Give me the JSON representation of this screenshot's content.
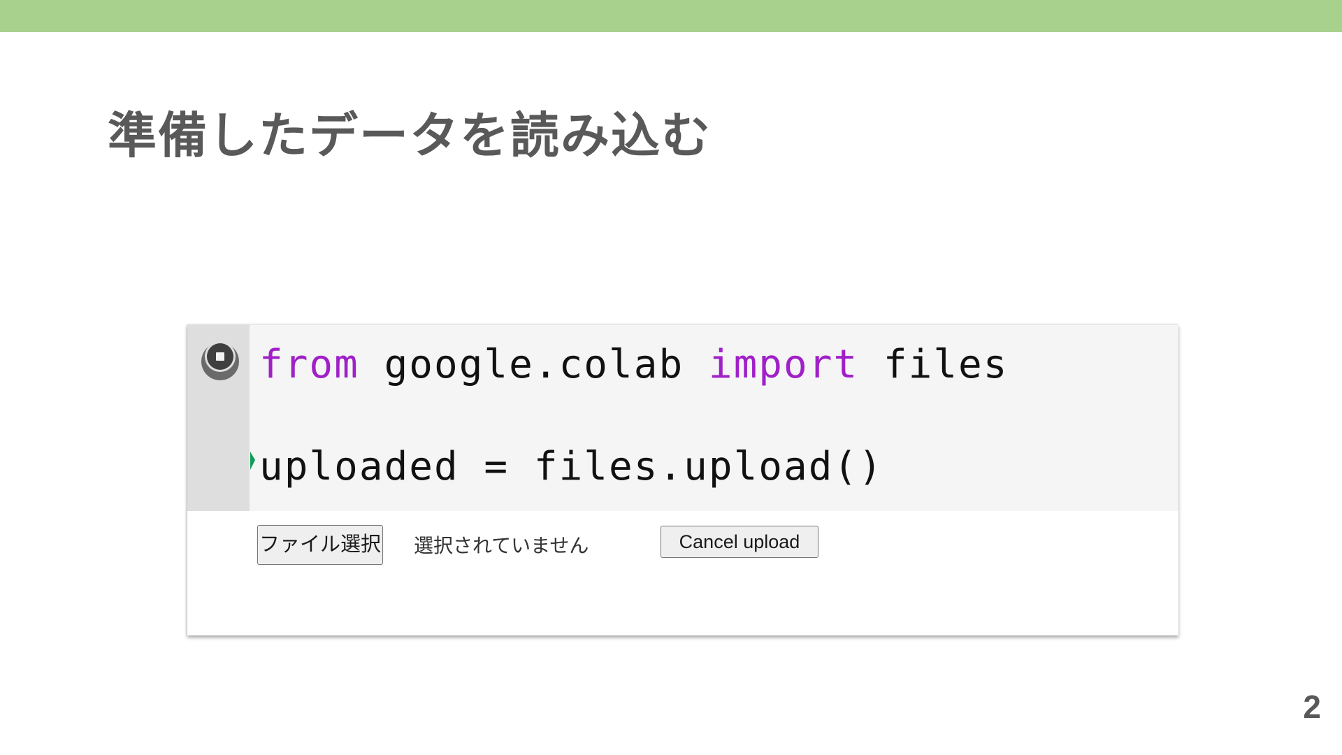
{
  "slide": {
    "title": "準備したデータを読み込む",
    "page_number": "2",
    "accent_color": "#a9d18e"
  },
  "colab_cell": {
    "code": {
      "line1": {
        "kw_from": "from",
        "module": " google.colab ",
        "kw_import": "import",
        "name": " files"
      },
      "line2": "uploaded = files.upload()"
    },
    "stop_icon": "stop-circle-icon",
    "run_marker_icon": "green-triangle-icon",
    "output": {
      "file_button_label": "ファイル選択",
      "file_status": "選択されていません",
      "cancel_button_label": "Cancel upload"
    }
  }
}
